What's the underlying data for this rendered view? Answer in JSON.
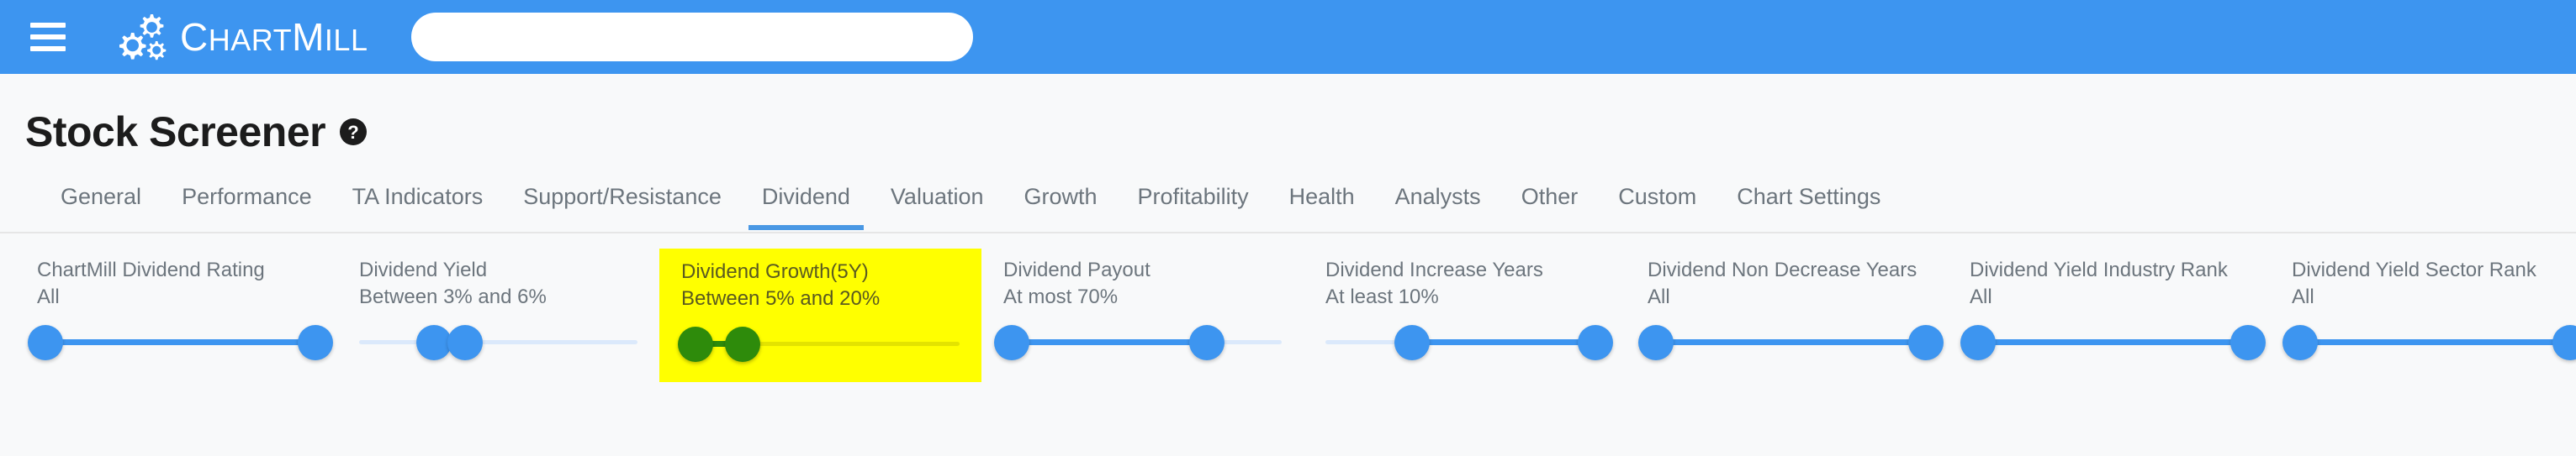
{
  "topbar": {
    "menu_icon": "hamburger-icon",
    "brand_logo_icon": "gears-icon",
    "brand_name": "ChartMill",
    "brand_part1": "C",
    "brand_part2": "HART",
    "brand_part3": "M",
    "brand_part4": "ILL",
    "search_value": "",
    "search_placeholder": "",
    "background_color": "#3d95f0"
  },
  "header": {
    "title": "Stock Screener",
    "help_icon": "question-mark-circle-icon"
  },
  "tabs": {
    "active": "Dividend",
    "items": [
      {
        "label": "General",
        "active": false
      },
      {
        "label": "Performance",
        "active": false
      },
      {
        "label": "TA Indicators",
        "active": false
      },
      {
        "label": "Support/Resistance",
        "active": false
      },
      {
        "label": "Dividend",
        "active": true
      },
      {
        "label": "Valuation",
        "active": false
      },
      {
        "label": "Growth",
        "active": false
      },
      {
        "label": "Profitability",
        "active": false
      },
      {
        "label": "Health",
        "active": false
      },
      {
        "label": "Analysts",
        "active": false
      },
      {
        "label": "Other",
        "active": false
      },
      {
        "label": "Custom",
        "active": false
      },
      {
        "label": "Chart Settings",
        "active": false
      }
    ]
  },
  "colors": {
    "accent_blue": "#3d95f0",
    "rail_blue": "#dbe9fb",
    "highlight_yellow": "#ffff00",
    "highlight_green": "#2e8b0b",
    "tab_text": "#6c757d"
  },
  "filters": [
    {
      "label": "ChartMill Dividend Rating",
      "value": "All",
      "highlighted": false,
      "left_pct": 3,
      "right_pct": 100
    },
    {
      "label": "Dividend Yield",
      "value": "Between 3% and 6%",
      "highlighted": false,
      "left_pct": 27,
      "right_pct": 38
    },
    {
      "label": "Dividend Growth(5Y)",
      "value": "Between 5% and 20%",
      "highlighted": true,
      "left_pct": 5,
      "right_pct": 22
    },
    {
      "label": "Dividend Payout",
      "value": "At most 70%",
      "highlighted": false,
      "left_pct": 3,
      "right_pct": 73
    },
    {
      "label": "Dividend Increase Years",
      "value": "At least 10%",
      "highlighted": false,
      "left_pct": 31,
      "right_pct": 97
    },
    {
      "label": "Dividend Non Decrease Years",
      "value": "All",
      "highlighted": false,
      "left_pct": 3,
      "right_pct": 100
    },
    {
      "label": "Dividend Yield Industry Rank",
      "value": "All",
      "highlighted": false,
      "left_pct": 3,
      "right_pct": 100
    },
    {
      "label": "Dividend Yield Sector Rank",
      "value": "All",
      "highlighted": false,
      "left_pct": 3,
      "right_pct": 100
    }
  ]
}
